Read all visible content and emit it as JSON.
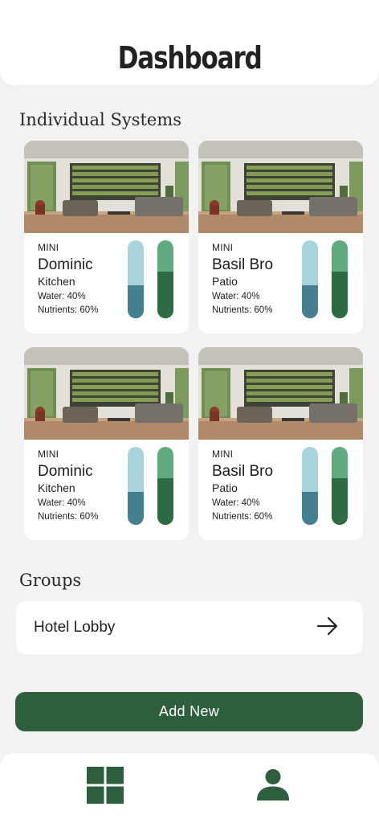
{
  "header": {
    "title": "Dashboard"
  },
  "sections": {
    "individual_title": "Individual Systems",
    "groups_title": "Groups"
  },
  "systems": [
    {
      "size": "MINI",
      "name": "Dominic",
      "location": "Kitchen",
      "water_text": "Water: 40%",
      "nutrients_text": "Nutrients: 60%",
      "water_level": 0.42,
      "nutrient_level": 0.6
    },
    {
      "size": "MINI",
      "name": "Basil Bro",
      "location": "Patio",
      "water_text": "Water: 40%",
      "nutrients_text": "Nutrients: 60%",
      "water_level": 0.42,
      "nutrient_level": 0.6
    },
    {
      "size": "MINI",
      "name": "Dominic",
      "location": "Kitchen",
      "water_text": "Water: 40%",
      "nutrients_text": "Nutrients: 60%",
      "water_level": 0.42,
      "nutrient_level": 0.6
    },
    {
      "size": "MINI",
      "name": "Basil Bro",
      "location": "Patio",
      "water_text": "Water: 40%",
      "nutrients_text": "Nutrients: 60%",
      "water_level": 0.42,
      "nutrient_level": 0.6
    }
  ],
  "groups": [
    {
      "label": "Hotel Lobby",
      "icon": "arrow-right-icon"
    }
  ],
  "actions": {
    "add_new_label": "Add New"
  },
  "nav": {
    "items": [
      {
        "icon": "dashboard-grid-icon"
      },
      {
        "icon": "user-profile-icon"
      }
    ]
  },
  "colors": {
    "primary_green": "#2d5f3e",
    "water_light": "#a8d4dc",
    "water_dark": "#44808f",
    "nutrient_light": "#5faa7f",
    "nutrient_dark": "#2e6a43",
    "background": "#f2f2f2"
  }
}
